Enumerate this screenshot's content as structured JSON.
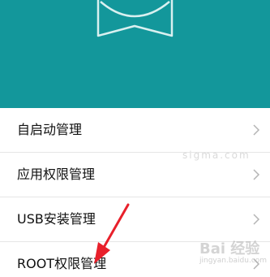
{
  "header": {
    "background_color": "#13979b",
    "emblem_icon": "shield-emblem-icon"
  },
  "settings_list": {
    "items": [
      {
        "label": "自启动管理",
        "icon": "chevron-right-icon"
      },
      {
        "label": "应用权限管理",
        "icon": "chevron-right-icon"
      },
      {
        "label": "USB安装管理",
        "icon": "chevron-right-icon"
      },
      {
        "label": "ROOT权限管理",
        "icon": "chevron-right-icon"
      }
    ]
  },
  "annotation": {
    "arrow_color": "#e8202b"
  },
  "watermark": {
    "brand": "Bai 经验",
    "url": "jingyan.baidu.com",
    "faint_text": "sigma.com"
  }
}
